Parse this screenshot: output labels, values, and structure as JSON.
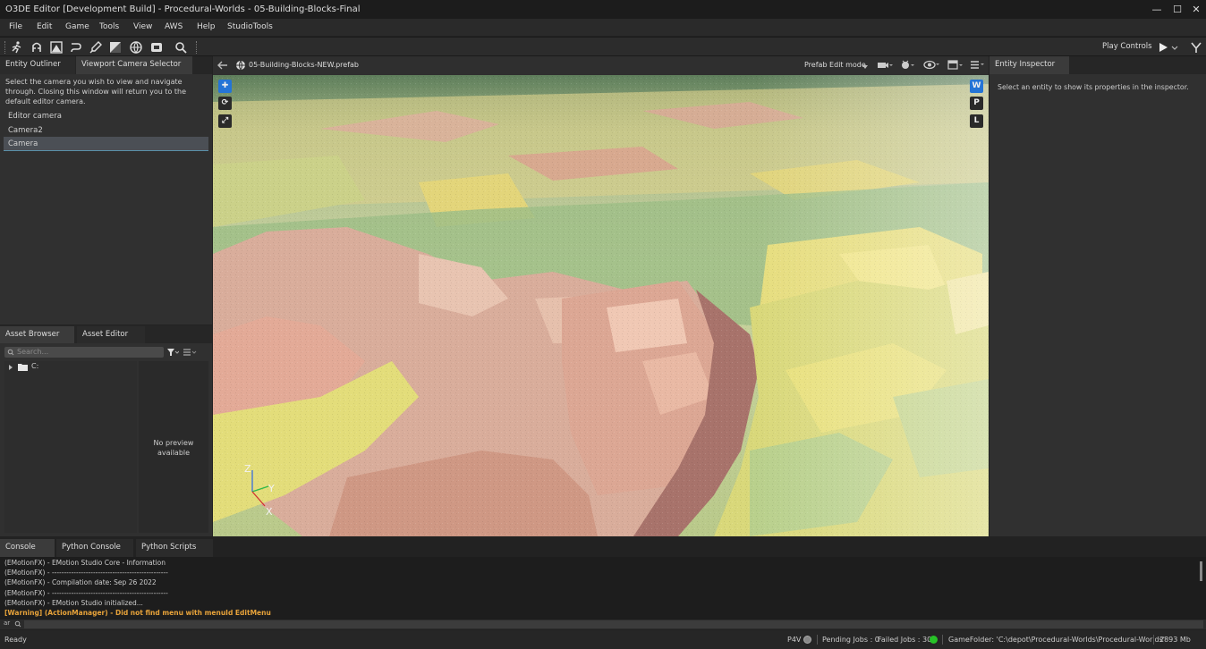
{
  "window": {
    "title": "O3DE Editor [Development Build] - Procedural-Worlds - 05-Building-Blocks-Final"
  },
  "menu": [
    "File",
    "Edit",
    "Game",
    "Tools",
    "View",
    "AWS",
    "Help",
    "StudioTools"
  ],
  "toolbar": {
    "play_controls_label": "Play Controls"
  },
  "left_top": {
    "tabs": [
      "Entity Outliner",
      "Viewport Camera Selector"
    ],
    "description": "Select the camera you wish to view and navigate through. Closing this window will return you to the default editor camera.",
    "cameras": [
      "Editor camera",
      "Camera2",
      "Camera"
    ],
    "selected_camera": "Camera"
  },
  "left_bottom": {
    "tabs": [
      "Asset Browser",
      "Asset Editor"
    ],
    "search_placeholder": "Search...",
    "tree_root": "C:",
    "preview_text": "No preview available"
  },
  "viewport": {
    "prefab_name": "05-Building-Blocks-NEW.prefab",
    "mode_label": "Prefab Edit mode",
    "wpl": [
      "W",
      "P",
      "L"
    ],
    "axes": {
      "z": "Z",
      "y": "Y",
      "x": "X"
    }
  },
  "inspector": {
    "tab": "Entity Inspector",
    "hint": "Select an entity to show its properties in the inspector."
  },
  "console": {
    "tabs": [
      "Console",
      "Python Console",
      "Python Scripts"
    ],
    "lines": [
      "(EMotionFX) - EMotion Studio Core - Information",
      "(EMotionFX) - ------------------------------------------------",
      "(EMotionFX) - Compilation date: Sep 26 2022",
      "(EMotionFX) - ------------------------------------------------",
      "(EMotionFX) - EMotion Studio initialized..."
    ],
    "warning": "[Warning] (ActionManager) - Did not find menu with menuId EditMenu",
    "warning_color": "#e8a33a",
    "input_prefix": "ar"
  },
  "status": {
    "ready": "Ready",
    "p4v": "P4V",
    "pending_jobs": "Pending Jobs : 0",
    "failed_jobs": "Failed Jobs : 30",
    "game_folder": "GameFolder: 'C:\\depot\\Procedural-Worlds\\Procedural-Worlds'",
    "memory": "2893 Mb",
    "ok_color": "#27c227"
  }
}
